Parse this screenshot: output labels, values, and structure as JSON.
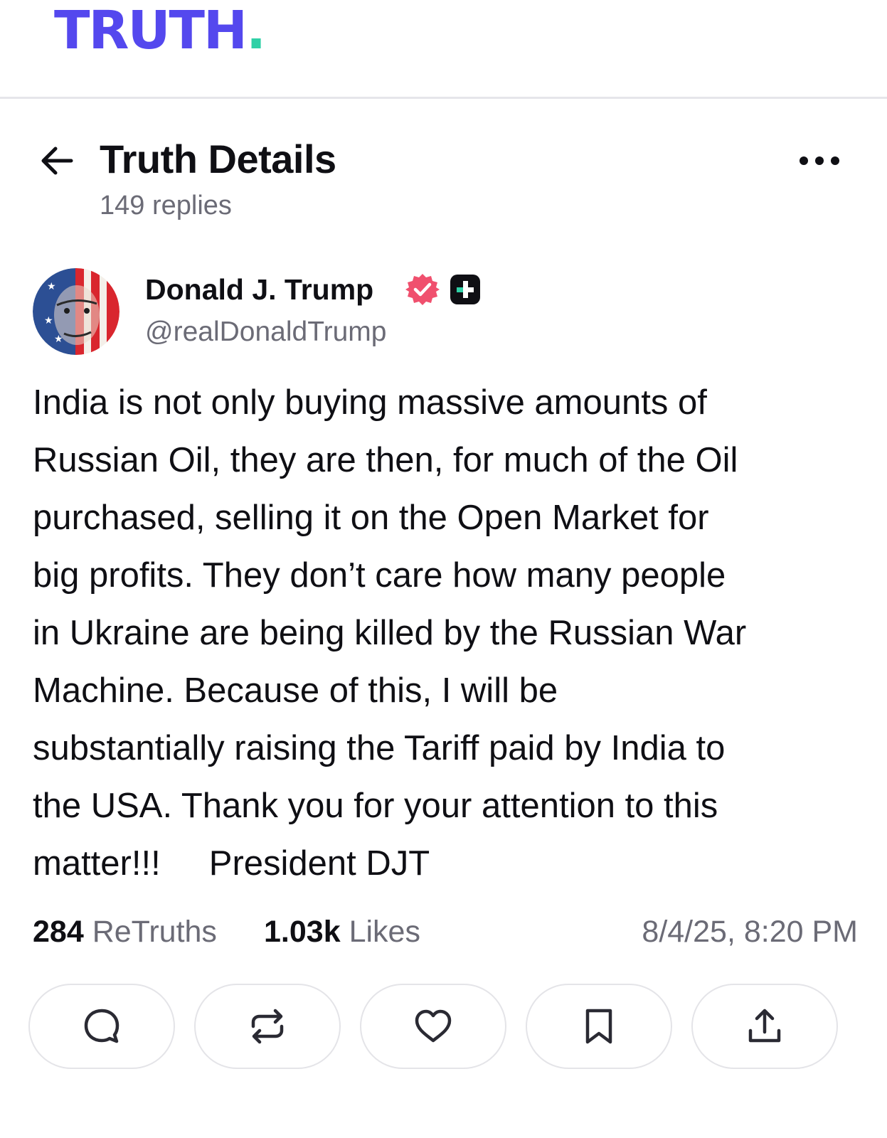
{
  "brand": {
    "logo_text": "TRUTH",
    "logo_dot": ".",
    "logo_color": "#5448ee",
    "dot_color": "#2fd0a6"
  },
  "header": {
    "title": "Truth Details",
    "replies": "149 replies",
    "back_icon": "arrow-left-icon",
    "more_icon": "more-horizontal-icon"
  },
  "post": {
    "author_name": "Donald J. Trump",
    "handle": "@realDonaldTrump",
    "verified_icon": "verified-badge-icon",
    "verified_color": "#f0506e",
    "plus_icon": "plus-badge-icon",
    "lines": [
      "India is not only buying massive amounts of",
      "Russian Oil, they are then, for much of the Oil",
      "purchased, selling it on the Open Market for",
      "big profits. They don’t care how many people",
      "in Ukraine are being killed by the Russian War",
      "Machine. Because of this, I will be",
      "substantially raising the Tariff paid by India to",
      "the USA. Thank you for your attention to this",
      "matter!!!     President DJT"
    ]
  },
  "stats": {
    "retruths_count": "284",
    "retruths_label": "ReTruths",
    "likes_count": "1.03k",
    "likes_label": "Likes",
    "timestamp": "8/4/25, 8:20 PM"
  },
  "actions": [
    {
      "icon": "reply-icon"
    },
    {
      "icon": "retruth-icon"
    },
    {
      "icon": "like-icon"
    },
    {
      "icon": "bookmark-icon"
    },
    {
      "icon": "share-icon"
    }
  ]
}
